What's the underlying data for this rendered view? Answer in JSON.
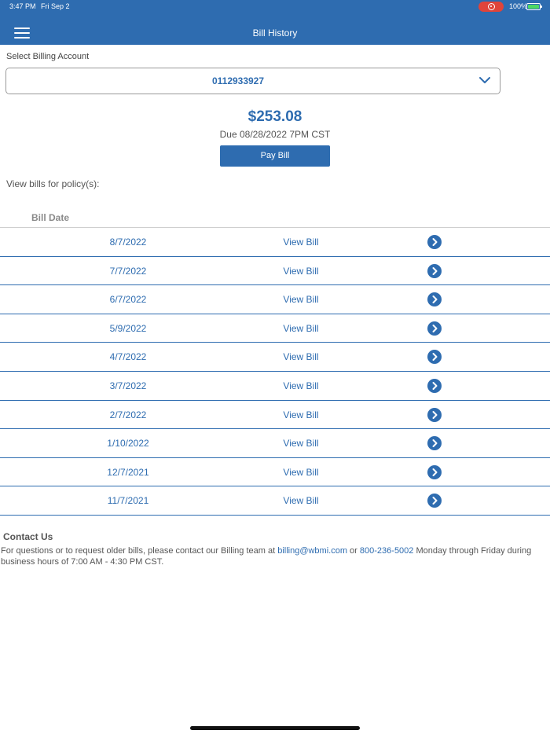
{
  "status_bar": {
    "time": "3:47 PM",
    "date": "Fri Sep 2",
    "battery": "100%",
    "record_color": "#e0443a"
  },
  "header": {
    "title": "Bill History",
    "menu_icon": "hamburger-menu-icon",
    "background": "#2e6cb0"
  },
  "account": {
    "label": "Select Billing Account",
    "value": "0112933927",
    "icon": "chevron-down-icon"
  },
  "summary": {
    "amount": "$253.08",
    "due": "Due 08/28/2022 7PM CST",
    "pay_label": "Pay Bill"
  },
  "policy_label": "View bills for policy(s):",
  "table": {
    "column_header": "Bill Date",
    "row_icon": "chevron-right-circle-icon",
    "rows": [
      {
        "date": "8/7/2022",
        "link": "View Bill"
      },
      {
        "date": "7/7/2022",
        "link": "View Bill"
      },
      {
        "date": "6/7/2022",
        "link": "View Bill"
      },
      {
        "date": "5/9/2022",
        "link": "View Bill"
      },
      {
        "date": "4/7/2022",
        "link": "View Bill"
      },
      {
        "date": "3/7/2022",
        "link": "View Bill"
      },
      {
        "date": "2/7/2022",
        "link": "View Bill"
      },
      {
        "date": "1/10/2022",
        "link": "View Bill"
      },
      {
        "date": "12/7/2021",
        "link": "View Bill"
      },
      {
        "date": "11/7/2021",
        "link": "View Bill"
      }
    ]
  },
  "contact": {
    "title": "Contact Us",
    "text_before": "For questions or to request older bills, please contact our Billing team at ",
    "email": "billing@wbmi.com",
    "or": " or ",
    "phone": "800-236-5002",
    "text_after": " Monday through Friday during business hours of 7:00 AM - 4:30 PM CST."
  },
  "accent_color": "#2e6cb0"
}
